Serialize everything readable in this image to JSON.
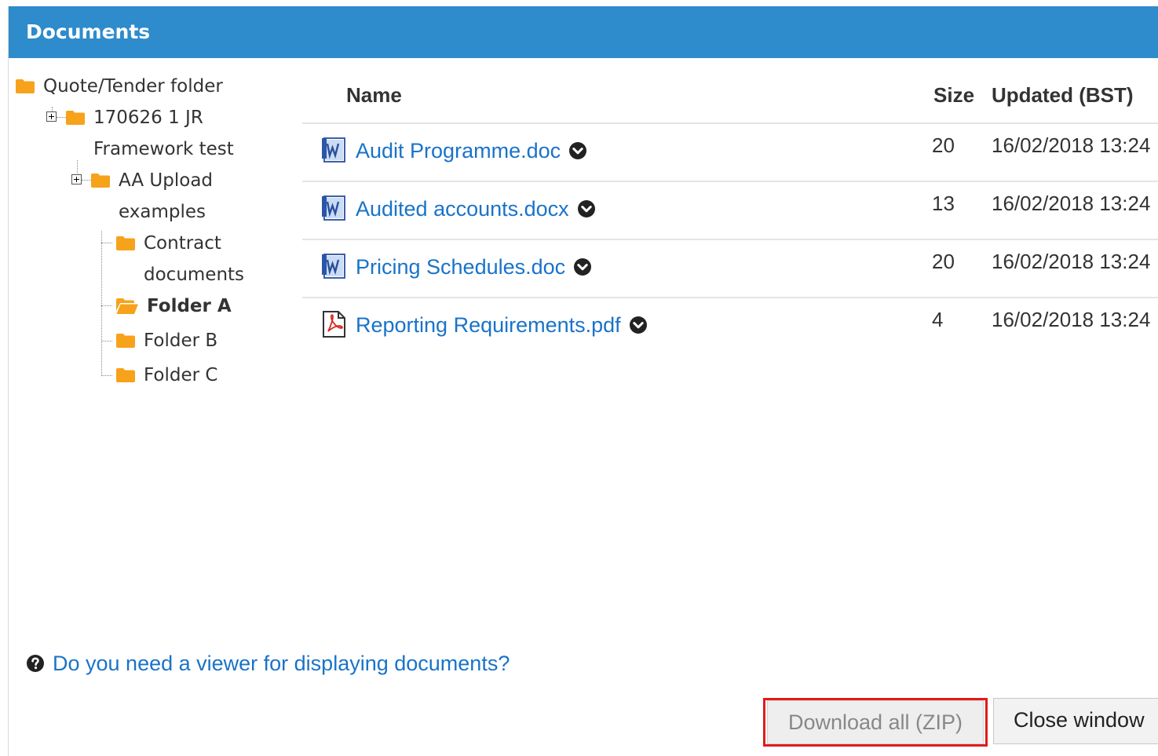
{
  "window": {
    "title": "Documents"
  },
  "tree": {
    "root": "Quote/Tender folder",
    "node1": [
      "170626 1 JR",
      "Framework test"
    ],
    "node2": [
      "AA Upload",
      "examples"
    ],
    "node3": [
      "Contract",
      "documents"
    ],
    "node4": "Folder A",
    "node5": "Folder B",
    "node6": "Folder C"
  },
  "table": {
    "headers": {
      "name": "Name",
      "size": "Size",
      "updated": "Updated (BST)"
    },
    "rows": [
      {
        "name": "Audit Programme.doc",
        "size": "20",
        "updated": "16/02/2018 13:24",
        "icon": "word-doc-icon"
      },
      {
        "name": "Audited accounts.docx",
        "size": "13",
        "updated": "16/02/2018 13:24",
        "icon": "word-doc-icon"
      },
      {
        "name": "Pricing Schedules.doc",
        "size": "20",
        "updated": "16/02/2018 13:24",
        "icon": "word-doc-icon"
      },
      {
        "name": "Reporting Requirements.pdf",
        "size": "4",
        "updated": "16/02/2018 13:24",
        "icon": "pdf-icon"
      }
    ]
  },
  "footer": {
    "help_link": "Do you need a viewer for displaying documents?",
    "download_zip": "Download all (ZIP)",
    "close_window": "Close window"
  },
  "colors": {
    "titlebar": "#2e8bcc",
    "link": "#1a73c8",
    "folder": "#f7a21b",
    "highlight_outline": "#e01b1b"
  }
}
